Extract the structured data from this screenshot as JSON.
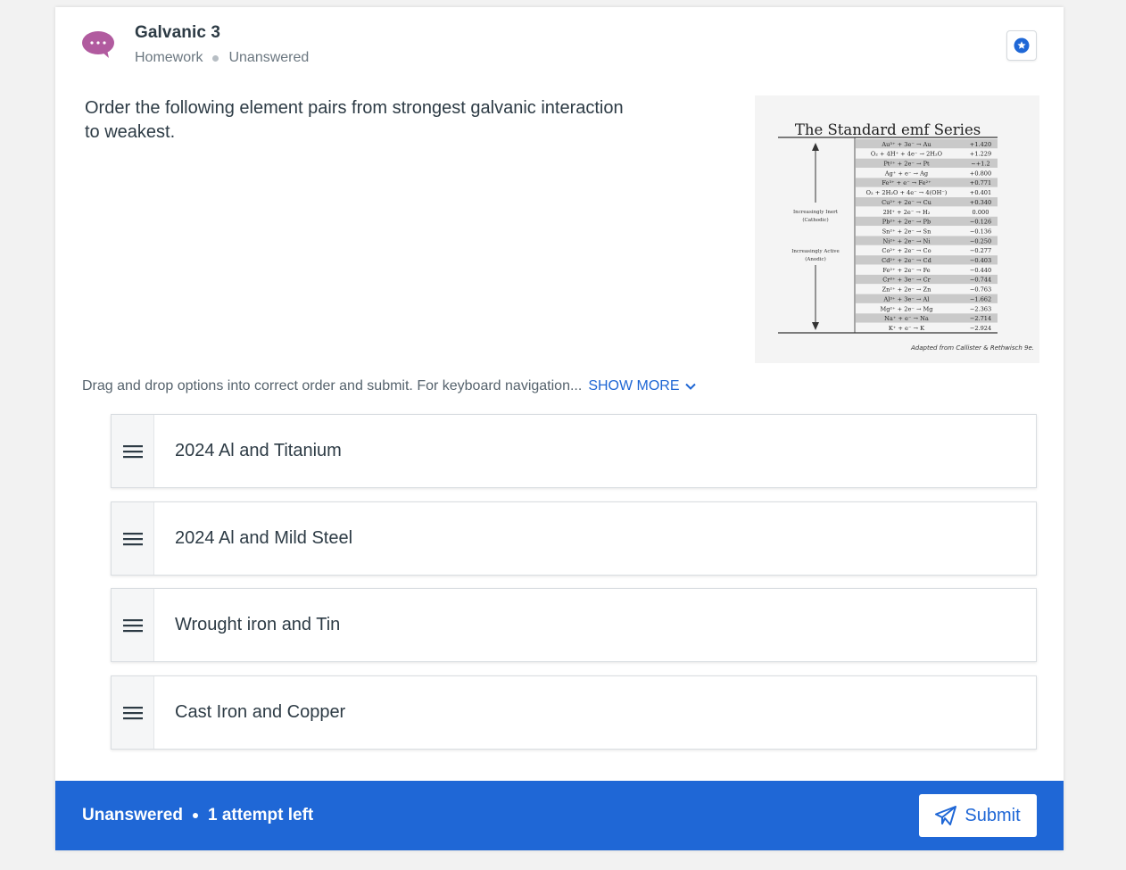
{
  "question": {
    "title": "Galvanic 3",
    "category": "Homework",
    "status": "Unanswered",
    "prompt": "Order the following element pairs from strongest galvanic interaction to weakest."
  },
  "figure": {
    "title": "The Standard emf Series",
    "left_label_top": [
      "Increasingly Inert",
      "(Cathodic)"
    ],
    "left_label_bottom": [
      "Increasingly Active",
      "(Anodic)"
    ],
    "reactions": [
      {
        "eq": "Au³⁺ + 3e⁻ → Au",
        "v": "+1.420"
      },
      {
        "eq": "O₂ + 4H⁺ + 4e⁻ → 2H₂O",
        "v": "+1.229"
      },
      {
        "eq": "Pt²⁺ + 2e⁻ → Pt",
        "v": "~+1.2"
      },
      {
        "eq": "Ag⁺ + e⁻ → Ag",
        "v": "+0.800"
      },
      {
        "eq": "Fe³⁺ + e⁻ → Fe²⁺",
        "v": "+0.771"
      },
      {
        "eq": "O₂ + 2H₂O + 4e⁻ → 4(OH⁻)",
        "v": "+0.401"
      },
      {
        "eq": "Cu²⁺ + 2e⁻ → Cu",
        "v": "+0.340"
      },
      {
        "eq": "2H⁺ + 2e⁻ → H₂",
        "v": "0.000"
      },
      {
        "eq": "Pb²⁺ + 2e⁻ → Pb",
        "v": "−0.126"
      },
      {
        "eq": "Sn²⁺ + 2e⁻ → Sn",
        "v": "−0.136"
      },
      {
        "eq": "Ni²⁺ + 2e⁻ → Ni",
        "v": "−0.250"
      },
      {
        "eq": "Co²⁺ + 2e⁻ → Co",
        "v": "−0.277"
      },
      {
        "eq": "Cd²⁺ + 2e⁻ → Cd",
        "v": "−0.403"
      },
      {
        "eq": "Fe²⁺ + 2e⁻ → Fe",
        "v": "−0.440"
      },
      {
        "eq": "Cr³⁺ + 3e⁻ → Cr",
        "v": "−0.744"
      },
      {
        "eq": "Zn²⁺ + 2e⁻ → Zn",
        "v": "−0.763"
      },
      {
        "eq": "Al³⁺ + 3e⁻ → Al",
        "v": "−1.662"
      },
      {
        "eq": "Mg²⁺ + 2e⁻ → Mg",
        "v": "−2.363"
      },
      {
        "eq": "Na⁺ + e⁻ → Na",
        "v": "−2.714"
      },
      {
        "eq": "K⁺ + e⁻ → K",
        "v": "−2.924"
      }
    ],
    "caption": "Adapted from Callister & Rethwisch 9e."
  },
  "instructions": {
    "text": "Drag and drop options into correct order and submit. For keyboard navigation...",
    "show_more": "SHOW MORE"
  },
  "options": [
    {
      "label": "2024 Al and Titanium"
    },
    {
      "label": "2024 Al and Mild Steel"
    },
    {
      "label": "Wrought iron and Tin"
    },
    {
      "label": "Cast Iron and Copper"
    }
  ],
  "footer": {
    "status": "Unanswered",
    "attempts": "1 attempt left",
    "submit_label": "Submit"
  },
  "colors": {
    "accent": "#1f67d6",
    "avatar": "#b15b9f"
  }
}
